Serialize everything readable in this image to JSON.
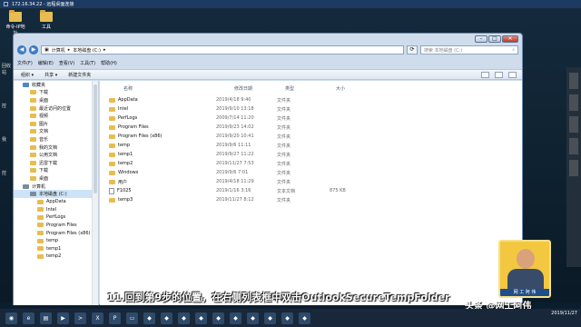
{
  "rdp": {
    "title": "172.16.34.22 - 远程桌面连接"
  },
  "desktop": {
    "icons": [
      {
        "label": "命令-IP地址"
      },
      {
        "label": "工具"
      }
    ],
    "side_labels": [
      "回收站",
      "控",
      "我",
      "控"
    ]
  },
  "explorer": {
    "breadcrumb": [
      "计算机",
      "本地磁盘 (C:)"
    ],
    "search_placeholder": "搜索 本地磁盘 (C:)",
    "menu": [
      "文件(F)",
      "编辑(E)",
      "查看(V)",
      "工具(T)",
      "帮助(H)"
    ],
    "toolbar": [
      "组织 ▾",
      "共享 ▾",
      "新建文件夹"
    ],
    "nav_items": [
      {
        "label": "收藏夹",
        "level": 1,
        "icon": "star-icon"
      },
      {
        "label": "下载",
        "level": 2,
        "icon": "folder-icon"
      },
      {
        "label": "桌面",
        "level": 2,
        "icon": "folder-icon"
      },
      {
        "label": "最近访问的位置",
        "level": 2,
        "icon": "folder-icon"
      },
      {
        "label": "视频",
        "level": 2,
        "icon": "folder-icon"
      },
      {
        "label": "图片",
        "level": 2,
        "icon": "folder-icon"
      },
      {
        "label": "文档",
        "level": 2,
        "icon": "folder-icon"
      },
      {
        "label": "音乐",
        "level": 2,
        "icon": "folder-icon"
      },
      {
        "label": "我的文档",
        "level": 2,
        "icon": "folder-icon"
      },
      {
        "label": "公用文档",
        "level": 2,
        "icon": "folder-icon"
      },
      {
        "label": "迅雷下载",
        "level": 2,
        "icon": "folder-icon"
      },
      {
        "label": "下载",
        "level": 2,
        "icon": "folder-icon"
      },
      {
        "label": "桌面",
        "level": 2,
        "icon": "folder-icon"
      },
      {
        "label": "计算机",
        "level": 1,
        "icon": "computer-icon"
      },
      {
        "label": "本地磁盘 (C:)",
        "level": 2,
        "icon": "drive-icon",
        "selected": true
      },
      {
        "label": "AppData",
        "level": 3,
        "icon": "folder-icon"
      },
      {
        "label": "Intel",
        "level": 3,
        "icon": "folder-icon"
      },
      {
        "label": "PerfLogs",
        "level": 3,
        "icon": "folder-icon"
      },
      {
        "label": "Program Files",
        "level": 3,
        "icon": "folder-icon"
      },
      {
        "label": "Program Files (x86)",
        "level": 3,
        "icon": "folder-icon"
      },
      {
        "label": "temp",
        "level": 3,
        "icon": "folder-icon"
      },
      {
        "label": "temp1",
        "level": 3,
        "icon": "folder-icon"
      },
      {
        "label": "temp2",
        "level": 3,
        "icon": "folder-icon"
      }
    ],
    "columns": {
      "name": "名称",
      "date": "修改日期",
      "type": "类型",
      "size": "大小"
    },
    "files": [
      {
        "name": "AppData",
        "date": "2019/4/18 9:40",
        "type": "文件夹",
        "size": "",
        "icon": "folder-icon"
      },
      {
        "name": "Intel",
        "date": "2019/9/10 13:18",
        "type": "文件夹",
        "size": "",
        "icon": "folder-icon"
      },
      {
        "name": "PerfLogs",
        "date": "2009/7/14 11:20",
        "type": "文件夹",
        "size": "",
        "icon": "folder-icon"
      },
      {
        "name": "Program Files",
        "date": "2019/9/23 14:02",
        "type": "文件夹",
        "size": "",
        "icon": "folder-icon"
      },
      {
        "name": "Program Files (x86)",
        "date": "2019/9/20 10:41",
        "type": "文件夹",
        "size": "",
        "icon": "folder-icon"
      },
      {
        "name": "temp",
        "date": "2019/9/6 11:11",
        "type": "文件夹",
        "size": "",
        "icon": "folder-icon"
      },
      {
        "name": "temp1",
        "date": "2019/9/27 11:22",
        "type": "文件夹",
        "size": "",
        "icon": "folder-icon"
      },
      {
        "name": "temp2",
        "date": "2019/11/27 7:53",
        "type": "文件夹",
        "size": "",
        "icon": "folder-icon"
      },
      {
        "name": "Windows",
        "date": "2019/9/6 7:01",
        "type": "文件夹",
        "size": "",
        "icon": "folder-icon"
      },
      {
        "name": "用户",
        "date": "2019/4/18 11:29",
        "type": "文件夹",
        "size": "",
        "icon": "folder-icon"
      },
      {
        "name": "F1025",
        "date": "2019/1/16 3:16",
        "type": "文本文档",
        "size": "875 KB",
        "icon": "file-icon"
      },
      {
        "name": "temp3",
        "date": "2019/11/27 8:12",
        "type": "文件夹",
        "size": "",
        "icon": "folder-icon"
      }
    ]
  },
  "caption": "11.回到第9步的位置，在右侧列表框中双击OutlookSecureTempFolder",
  "avatar_tag": "网 工 阿 伟",
  "watermark": "头条 @网工阿伟",
  "taskbar": {
    "icons": [
      "start-icon",
      "ie-icon",
      "explorer-icon",
      "media-icon",
      "cmd-icon",
      "excel-icon",
      "ps-icon",
      "folder-icon",
      "app-icon",
      "app-icon",
      "app-icon",
      "app-icon",
      "app-icon",
      "app-icon",
      "app-icon",
      "app-icon",
      "app-icon",
      "app-icon"
    ],
    "time": "2019/11/27"
  }
}
